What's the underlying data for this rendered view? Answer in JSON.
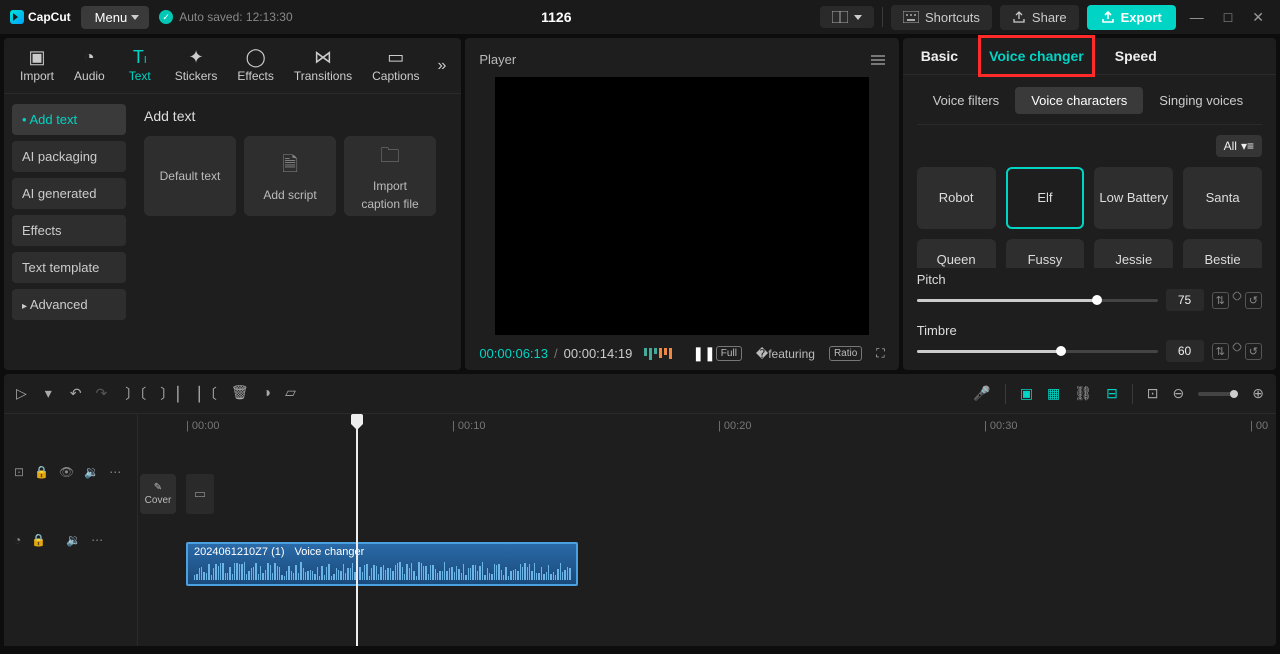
{
  "topbar": {
    "brand": "CapCut",
    "menu": "Menu",
    "autosaved": "Auto saved: 12:13:30",
    "title": "1126",
    "shortcuts": "Shortcuts",
    "share": "Share",
    "export": "Export"
  },
  "mediaTabs": {
    "import": "Import",
    "audio": "Audio",
    "text": "Text",
    "stickers": "Stickers",
    "effects": "Effects",
    "transitions": "Transitions",
    "captions": "Captions"
  },
  "textNav": {
    "addText": "Add text",
    "aiPackaging": "AI packaging",
    "aiGenerated": "AI generated",
    "effects": "Effects",
    "textTemplate": "Text template",
    "advanced": "Advanced"
  },
  "textCards": {
    "heading": "Add text",
    "default": "Default text",
    "addScript": "Add script",
    "importCaption1": "Import",
    "importCaption2": "caption file"
  },
  "player": {
    "title": "Player",
    "current": "00:00:06:13",
    "total": "00:00:14:19",
    "full": "Full",
    "ratio": "Ratio"
  },
  "rightPanel": {
    "basic": "Basic",
    "voiceChanger": "Voice changer",
    "speed": "Speed",
    "voiceFilters": "Voice filters",
    "voiceCharacters": "Voice characters",
    "singingVoices": "Singing voices",
    "all": "All"
  },
  "voices": {
    "r0c0": "Robot",
    "r0c1": "Elf",
    "r0c2": "Low Battery",
    "r0c3": "Santa",
    "r1c0": "Queen",
    "r1c1": "Fussy",
    "r1c2": "Jessie",
    "r1c3": "Bestie"
  },
  "sliders": {
    "pitchLabel": "Pitch",
    "pitchVal": "75",
    "timbreLabel": "Timbre",
    "timbreVal": "60"
  },
  "ruler": {
    "t0": "| 00:00",
    "t10": "| 00:10",
    "t20": "| 00:20",
    "t30": "| 00:30",
    "t40": "| 00"
  },
  "cover": "Cover",
  "clip": {
    "name": "2024061210Z7 (1)",
    "tag": "Voice changer"
  }
}
